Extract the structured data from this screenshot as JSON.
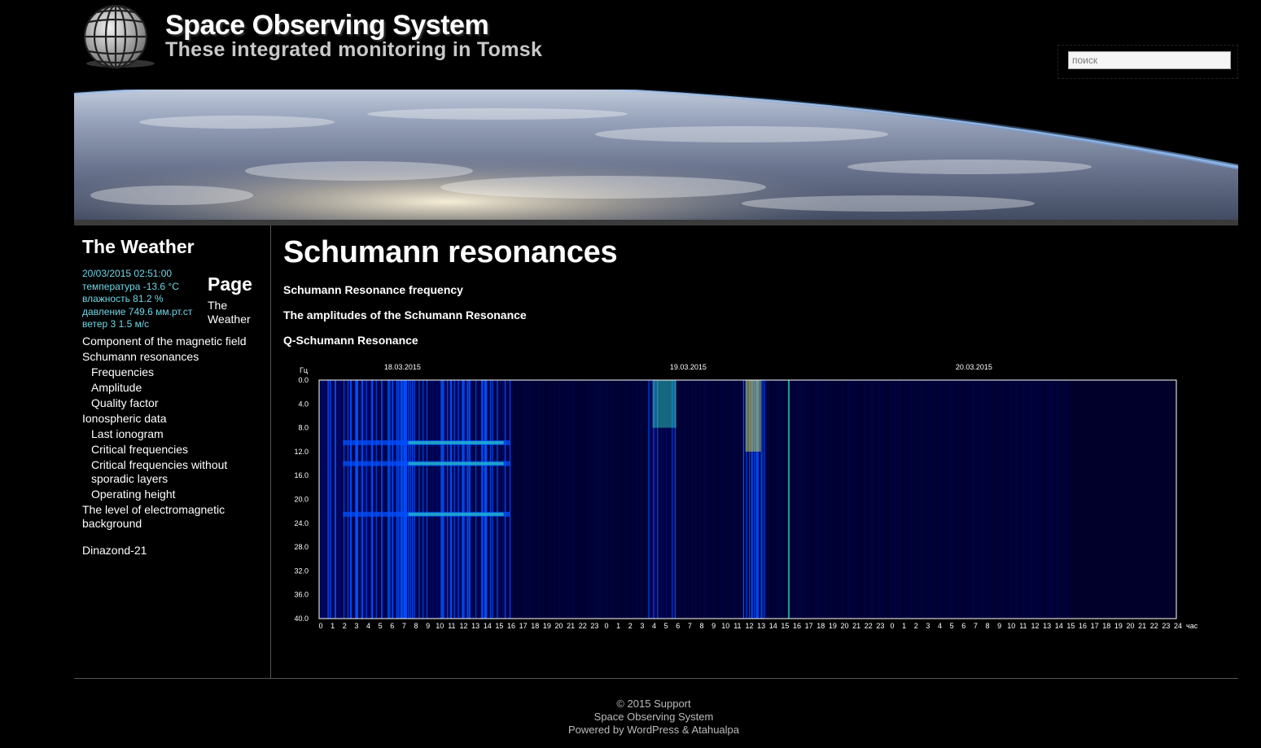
{
  "header": {
    "title": "Space Observing System",
    "tagline": "These integrated monitoring in Tomsk",
    "search_placeholder": "поиск"
  },
  "sidebar": {
    "weather": {
      "title": "The Weather",
      "datetime": "20/03/2015 02:51:00",
      "temperature": "температура -13.6 °C",
      "humidity": "влажность 81.2 %",
      "pressure": "давление 749.6 мм.рт.ст",
      "wind": "ветер 3 1.5 м/с"
    },
    "page_widget": {
      "title": "Page",
      "link": "The Weather"
    },
    "nav": [
      {
        "label": "Component of the magnetic field",
        "level": 0
      },
      {
        "label": "Schumann resonances",
        "level": 0
      },
      {
        "label": "Frequencies",
        "level": 1
      },
      {
        "label": "Amplitude",
        "level": 1
      },
      {
        "label": "Quality factor",
        "level": 1
      },
      {
        "label": "Ionospheric data",
        "level": 0
      },
      {
        "label": "Last ionogram",
        "level": 1
      },
      {
        "label": "Critical frequencies",
        "level": 1
      },
      {
        "label": "Critical frequencies without sporadic layers",
        "level": 1
      },
      {
        "label": "Operating height",
        "level": 1
      },
      {
        "label": "The level of electromagnetic background",
        "level": 0
      },
      {
        "label": "Dinazond-21",
        "level": 0
      }
    ]
  },
  "main": {
    "title": "Schumann resonances",
    "links": [
      "Schumann Resonance frequency",
      "The amplitudes of the Schumann Resonance",
      "Q-Schumann Resonance"
    ]
  },
  "chart_data": {
    "type": "heatmap",
    "y_unit": "Гц",
    "x_unit": "час",
    "dates": [
      "18.03.2015",
      "19.03.2015",
      "20.03.2015"
    ],
    "y_ticks": [
      "0.0",
      "4.0",
      "8.0",
      "12.0",
      "16.0",
      "20.0",
      "24.0",
      "28.0",
      "32.0",
      "36.0",
      "40.0"
    ],
    "x_ticks": [
      "0",
      "1",
      "2",
      "3",
      "4",
      "5",
      "6",
      "7",
      "8",
      "9",
      "10",
      "11",
      "12",
      "13",
      "14",
      "15",
      "16",
      "17",
      "18",
      "19",
      "20",
      "21",
      "22",
      "23",
      "0",
      "1",
      "2",
      "3",
      "4",
      "5",
      "6",
      "7",
      "8",
      "9",
      "10",
      "11",
      "12",
      "13",
      "14",
      "15",
      "16",
      "17",
      "18",
      "19",
      "20",
      "21",
      "22",
      "23",
      "0",
      "1",
      "2",
      "3",
      "4",
      "5",
      "6",
      "7",
      "8",
      "9",
      "10",
      "11",
      "12",
      "13",
      "14",
      "15",
      "16",
      "17",
      "18",
      "19",
      "20",
      "21",
      "22",
      "23",
      "24"
    ],
    "ylim": [
      0,
      40
    ],
    "colors": {
      "background": "#00002a",
      "low": "#000a7a",
      "mid": "#0050ff",
      "high": "#30e0c0",
      "peak": "#f0f040"
    }
  },
  "footer": {
    "line1": "© 2015 Support",
    "line2": "Space Observing System",
    "line3": "Powered by WordPress & Atahualpa"
  }
}
